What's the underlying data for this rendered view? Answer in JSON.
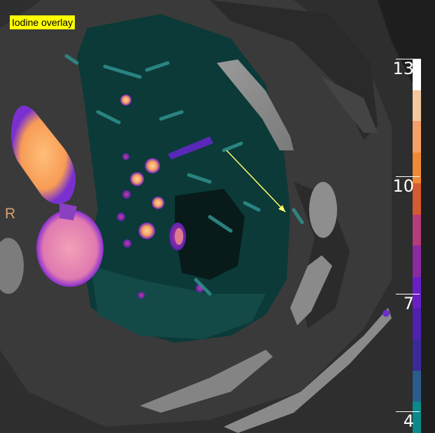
{
  "viewer": {
    "overlay_label": "Iodine overlay",
    "orientation_marker": "R"
  },
  "colorbar": {
    "ticks": [
      "13",
      "10",
      "7",
      "4"
    ],
    "colors_top_to_bottom": [
      "#ffffff",
      "#f7c8a0",
      "#f4a066",
      "#ee8a35",
      "#d65a30",
      "#b43c78",
      "#8a2aa0",
      "#6a1ec8",
      "#5020b0",
      "#3a2a9a",
      "#2a5c8c",
      "#0a8a8a"
    ]
  },
  "image_colors": {
    "background": "#000000",
    "soft_tissue": "#3a3a3a",
    "lung_fill": "#0b3a38",
    "iodine_high": "#f9a860",
    "iodine_mid": "#e06aa0",
    "iodine_low": "#7a30d0",
    "arrow": "#ffff66"
  },
  "icons": [
    "arrow-annotation-icon"
  ]
}
